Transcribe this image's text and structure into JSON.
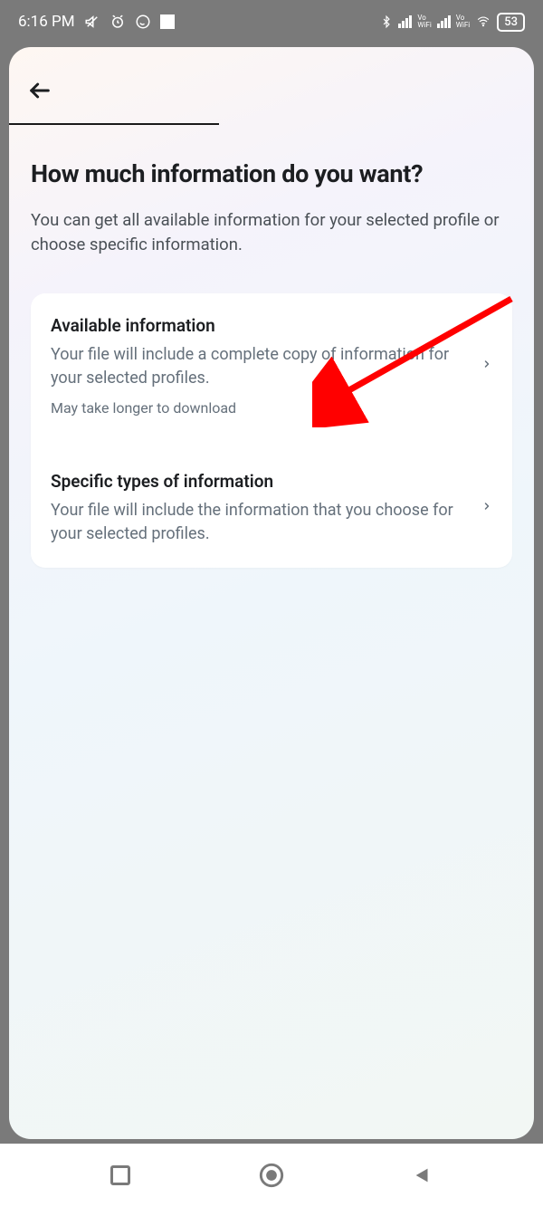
{
  "status": {
    "time": "6:16 PM",
    "battery": "53"
  },
  "page": {
    "title": "How much information do you want?",
    "subtitle": "You can get all available information for your selected profile or choose specific information."
  },
  "options": [
    {
      "title": "Available information",
      "description": "Your file will include a complete copy of information for your selected profiles.",
      "note": "May take longer to download"
    },
    {
      "title": "Specific types of information",
      "description": "Your file will include the information that you choose for your selected profiles."
    }
  ]
}
